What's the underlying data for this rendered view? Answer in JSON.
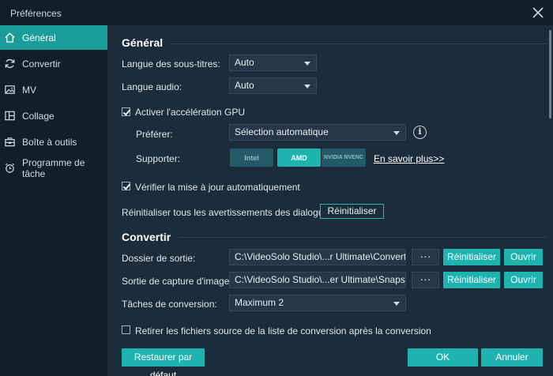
{
  "window": {
    "title": "Préférences"
  },
  "sidebar": {
    "items": [
      {
        "label": "Général",
        "icon": "home-icon",
        "active": true
      },
      {
        "label": "Convertir",
        "icon": "refresh-icon",
        "active": false
      },
      {
        "label": "MV",
        "icon": "photo-icon",
        "active": false
      },
      {
        "label": "Collage",
        "icon": "collage-icon",
        "active": false
      },
      {
        "label": "Boîte à outils",
        "icon": "toolbox-icon",
        "active": false
      },
      {
        "label": "Programme de tâche",
        "icon": "alarm-clock-icon",
        "active": false
      }
    ]
  },
  "general": {
    "heading": "Général",
    "subtitle_lang_label": "Langue des sous-titres:",
    "subtitle_lang_value": "Auto",
    "audio_lang_label": "Langue audio:",
    "audio_lang_value": "Auto",
    "gpu_accel_label": "Activer l'accélération GPU",
    "gpu_accel_checked": true,
    "prefer_label": "Préférer:",
    "prefer_value": "Sélection automatique",
    "support_label": "Supporter:",
    "gpus": [
      {
        "label": "Intel",
        "state": "disabled"
      },
      {
        "label": "AMD",
        "state": "active"
      },
      {
        "label": "NVIDIA NVENC",
        "state": "disabled"
      }
    ],
    "learn_more": "En savoir plus>>",
    "auto_update_label": "Vérifier la mise à jour automatiquement",
    "auto_update_checked": true,
    "reset_warnings_label": "Réinitialiser tous les avertissements des dialogues:",
    "reset_warnings_button": "Réinitialiser"
  },
  "convert": {
    "heading": "Convertir",
    "output_label": "Dossier de sortie:",
    "output_path": "C:\\VideoSolo Studio\\...r Ultimate\\Converted",
    "snapshot_label": "Sortie de capture d'image:",
    "snapshot_path": "C:\\VideoSolo Studio\\...er Ultimate\\Snapshot",
    "browse_label": "···",
    "reset_label": "Réinitialiser",
    "open_label": "Ouvrir",
    "tasks_label": "Tâches de conversion:",
    "tasks_value": "Maximum 2",
    "remove_source_label": "Retirer les fichiers source de la liste de conversion après la conversion",
    "remove_source_checked": false
  },
  "footer": {
    "restore_label": "Restaurer par défaut",
    "ok_label": "OK",
    "cancel_label": "Annuler"
  },
  "colors": {
    "accent": "#1fb3b0",
    "sidebar_active": "#1a9d9a",
    "background": "#1b2c3b"
  }
}
